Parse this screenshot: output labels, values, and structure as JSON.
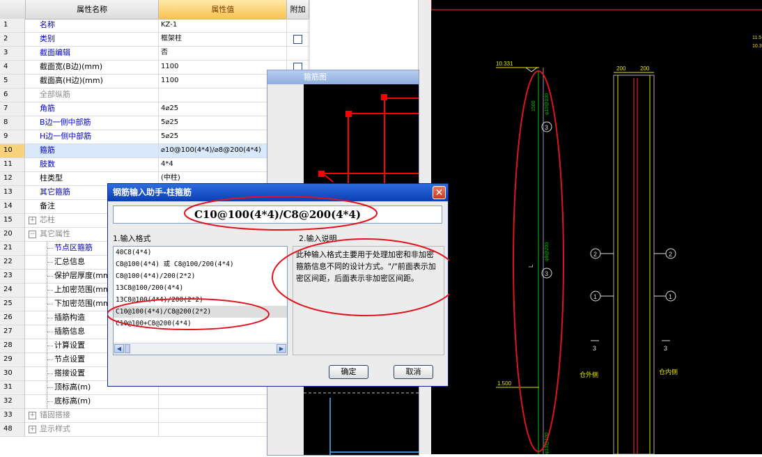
{
  "grid": {
    "header": {
      "name": "属性名称",
      "value": "属性值",
      "extra": "附加"
    },
    "rows": [
      {
        "num": "1",
        "name": "名称",
        "value": "KZ-1",
        "style": "blue",
        "check": false
      },
      {
        "num": "2",
        "name": "类别",
        "value": "框架柱",
        "style": "blue",
        "check": true
      },
      {
        "num": "3",
        "name": "截面编辑",
        "value": "否",
        "style": "blue",
        "check": false
      },
      {
        "num": "4",
        "name": "截面宽(B边)(mm)",
        "value": "1100",
        "style": "plain",
        "check": true
      },
      {
        "num": "5",
        "name": "截面高(H边)(mm)",
        "value": "1100",
        "style": "plain",
        "check": true
      },
      {
        "num": "6",
        "name": "全部纵筋",
        "value": "",
        "style": "gray",
        "check": true
      },
      {
        "num": "7",
        "name": "角筋",
        "value": "4⌀25",
        "style": "blue",
        "check": true
      },
      {
        "num": "8",
        "name": "B边一侧中部筋",
        "value": "5⌀25",
        "style": "blue",
        "check": true
      },
      {
        "num": "9",
        "name": "H边一侧中部筋",
        "value": "5⌀25",
        "style": "blue",
        "check": true
      },
      {
        "num": "10",
        "name": "箍筋",
        "value": "⌀10@100(4*4)/⌀8@200(4*4)",
        "style": "blue",
        "check": true,
        "selected": true
      },
      {
        "num": "11",
        "name": "肢数",
        "value": "4*4",
        "style": "blue",
        "check": false
      },
      {
        "num": "12",
        "name": "柱类型",
        "value": "(中柱)",
        "style": "plain",
        "check": true
      },
      {
        "num": "13",
        "name": "其它箍筋",
        "value": "",
        "style": "blue",
        "check": false
      },
      {
        "num": "14",
        "name": "备注",
        "value": "",
        "style": "plain",
        "check": false
      },
      {
        "num": "15",
        "name": "芯柱",
        "value": "",
        "style": "group-gray",
        "expander": "+"
      },
      {
        "num": "20",
        "name": "其它属性",
        "value": "",
        "style": "group-gray",
        "expander": "−"
      },
      {
        "num": "21",
        "name": "节点区箍筋",
        "value": "",
        "style": "child-blue"
      },
      {
        "num": "22",
        "name": "汇总信息",
        "value": "",
        "style": "child"
      },
      {
        "num": "23",
        "name": "保护层厚度(mm)",
        "value": "",
        "style": "child"
      },
      {
        "num": "24",
        "name": "上加密范围(mm)",
        "value": "",
        "style": "child"
      },
      {
        "num": "25",
        "name": "下加密范围(mm)",
        "value": "",
        "style": "child"
      },
      {
        "num": "26",
        "name": "插筋构造",
        "value": "",
        "style": "child"
      },
      {
        "num": "27",
        "name": "插筋信息",
        "value": "",
        "style": "child"
      },
      {
        "num": "28",
        "name": "计算设置",
        "value": "",
        "style": "child"
      },
      {
        "num": "29",
        "name": "节点设置",
        "value": "",
        "style": "child"
      },
      {
        "num": "30",
        "name": "搭接设置",
        "value": "",
        "style": "child"
      },
      {
        "num": "31",
        "name": "顶标高(m)",
        "value": "",
        "style": "child"
      },
      {
        "num": "32",
        "name": "底标高(m)",
        "value": "",
        "style": "child"
      },
      {
        "num": "33",
        "name": "锚固搭接",
        "value": "",
        "style": "group-gray",
        "expander": "+"
      },
      {
        "num": "48",
        "name": "显示样式",
        "value": "",
        "style": "group-gray",
        "expander": "+"
      }
    ]
  },
  "stirrup_window": {
    "title": "箍筋图"
  },
  "dialog": {
    "title": "钢筋输入助手-柱箍筋",
    "input_value": "C10@100(4*4)/C8@200(4*4)",
    "format_label": "1.输入格式",
    "desc_label": "2.输入说明",
    "formats": [
      "40C8(4*4)",
      "C8@100(4*4) 或 C8@100/200(4*4)",
      "C8@100(4*4)/200(2*2)",
      "13C8@100/200(4*4)",
      "13C8@100(4*4)/200(2*2)",
      "C10@100(4*4)/C8@200(2*2)",
      "C10@100+C8@200(4*4)"
    ],
    "selected_format_index": 5,
    "description": "此种输入格式主要用于处理加密和非加密箍筋信息不同的设计方式。\"/\"前面表示加密区间距，后面表示非加密区间距。",
    "ok_label": "确定",
    "cancel_label": "取消"
  },
  "cad": {
    "labels": {
      "elev_top": "10.331",
      "elev_bottom": "1.500",
      "dim_left": "200",
      "dim_right": "200",
      "span_top": "1500",
      "span_mid": "L",
      "note_top": "φ10@100",
      "note_mid": "φ8@200",
      "note_bottom": "φ10@100",
      "circle_3": "3",
      "circle_2": "2",
      "circle_1": "1",
      "section_left": "3",
      "section_right": "3",
      "side_outer": "仓外侧",
      "side_inner": "仓内侧",
      "corner_1": "11.5",
      "corner_2": "10.3"
    }
  },
  "colors": {
    "annotation": "#e0141e",
    "cad_green": "#00c800",
    "cad_yellow": "#e6e600",
    "rebar_red": "#ff0000"
  }
}
